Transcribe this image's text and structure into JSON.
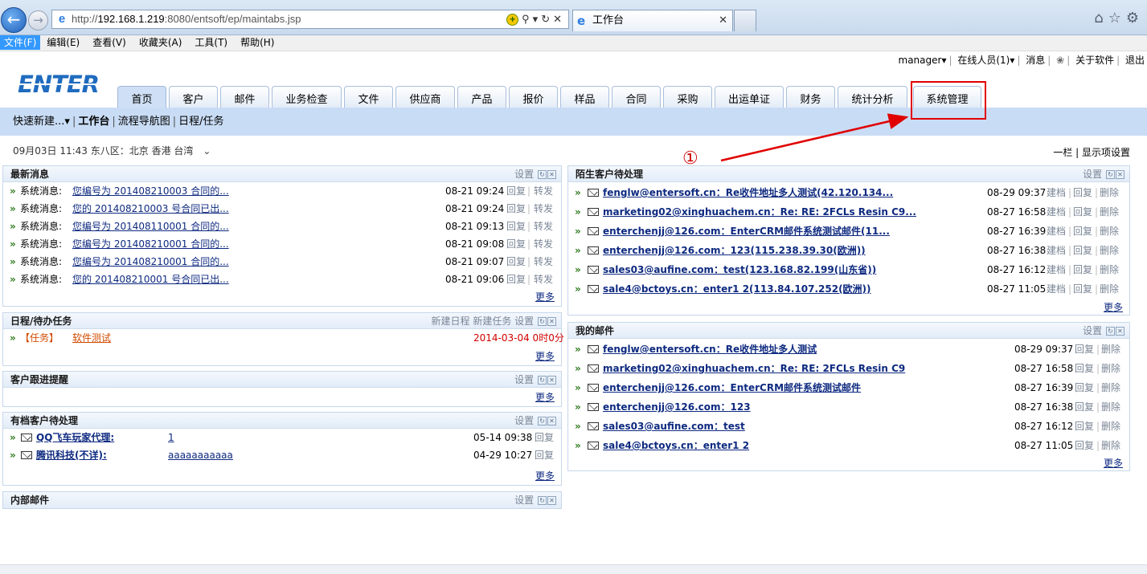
{
  "browser": {
    "url_prefix": "http://",
    "url_host": "192.168.1.219",
    "url_rest": ":8080/entsoft/ep/maintabs.jsp",
    "tab_title": "工作台",
    "menu": [
      "文件(F)",
      "编辑(E)",
      "查看(V)",
      "收藏夹(A)",
      "工具(T)",
      "帮助(H)"
    ]
  },
  "app": {
    "logo": "ENTER",
    "toplinks": {
      "user": "manager▾",
      "online": "在线人员(1)▾",
      "messages": "消息",
      "about": "关于软件",
      "exit": "退出"
    },
    "tabs": [
      "首页",
      "客户",
      "邮件",
      "业务检查",
      "文件",
      "供应商",
      "产品",
      "报价",
      "样品",
      "合同",
      "采购",
      "出运单证",
      "财务",
      "统计分析",
      "系统管理"
    ],
    "active_tab": "首页",
    "subnav": {
      "quick_new": "快速新建...▾",
      "workbench": "工作台",
      "flow_nav": "流程导航图",
      "schedule": "日程/任务"
    },
    "date": "09月03日  11:43 东八区：北京 香港 台湾",
    "layout_links": "一栏 | 显示项设置",
    "annotation": "①"
  },
  "labels": {
    "settings": "设置",
    "more": "更多",
    "reply": "回复",
    "forward": "转发",
    "archive": "建档",
    "delete": "删除",
    "new_schedule": "新建日程",
    "new_task": "新建任务"
  },
  "panels": {
    "news": {
      "title": "最新消息",
      "rows": [
        {
          "label": "系统消息:",
          "text": "您编号为 201408210003 合同的...",
          "time": "08-21 09:24"
        },
        {
          "label": "系统消息:",
          "text": "您的 201408210003 号合同已出...",
          "time": "08-21 09:24"
        },
        {
          "label": "系统消息:",
          "text": "您编号为 201408110001 合同的...",
          "time": "08-21 09:13"
        },
        {
          "label": "系统消息:",
          "text": "您编号为 201408210001 合同的...",
          "time": "08-21 09:08"
        },
        {
          "label": "系统消息:",
          "text": "您编号为 201408210001 合同的...",
          "time": "08-21 09:07"
        },
        {
          "label": "系统消息:",
          "text": "您的 201408210001 号合同已出...",
          "time": "08-21 09:06"
        }
      ]
    },
    "schedule": {
      "title": "日程/待办任务",
      "rows": [
        {
          "label": "【任务】",
          "text": "软件测试",
          "time": "2014-03-04 0时0分"
        }
      ]
    },
    "followup": {
      "title": "客户跟进提醒"
    },
    "archived": {
      "title": "有档客户待处理",
      "rows": [
        {
          "name": "QQ飞车玩家代理:",
          "subject": "1",
          "time": "05-14 09:38"
        },
        {
          "name": "腾讯科技(不详):",
          "subject": "aaaaaaaaaaa",
          "time": "04-29 10:27"
        }
      ]
    },
    "internal": {
      "title": "内部邮件"
    },
    "strangers": {
      "title": "陌生客户待处理",
      "rows": [
        {
          "text": "fenglw@entersoft.cn：Re收件地址多人测试(42.120.134...",
          "time": "08-29 09:37"
        },
        {
          "text": "marketing02@xinghuachem.cn：Re: RE: 2FCLs Resin C9...",
          "time": "08-27 16:58"
        },
        {
          "text": "enterchenjj@126.com：EnterCRM邮件系统测试邮件(11...",
          "time": "08-27 16:39"
        },
        {
          "text": "enterchenjj@126.com：123(115.238.39.30(欧洲))",
          "time": "08-27 16:38"
        },
        {
          "text": "sales03@aufine.com：test(123.168.82.199(山东省))",
          "time": "08-27 16:12"
        },
        {
          "text": "sale4@bctoys.cn：enter1 2(113.84.107.252(欧洲))",
          "time": "08-27 11:05"
        }
      ]
    },
    "mymail": {
      "title": "我的邮件",
      "rows": [
        {
          "text": "fenglw@entersoft.cn：Re收件地址多人测试",
          "time": "08-29 09:37"
        },
        {
          "text": "marketing02@xinghuachem.cn：Re: RE: 2FCLs Resin C9",
          "time": "08-27 16:58"
        },
        {
          "text": "enterchenjj@126.com：EnterCRM邮件系统测试邮件",
          "time": "08-27 16:39"
        },
        {
          "text": "enterchenjj@126.com：123",
          "time": "08-27 16:38"
        },
        {
          "text": "sales03@aufine.com：test",
          "time": "08-27 16:12"
        },
        {
          "text": "sale4@bctoys.cn：enter1 2",
          "time": "08-27 11:05"
        }
      ]
    }
  }
}
